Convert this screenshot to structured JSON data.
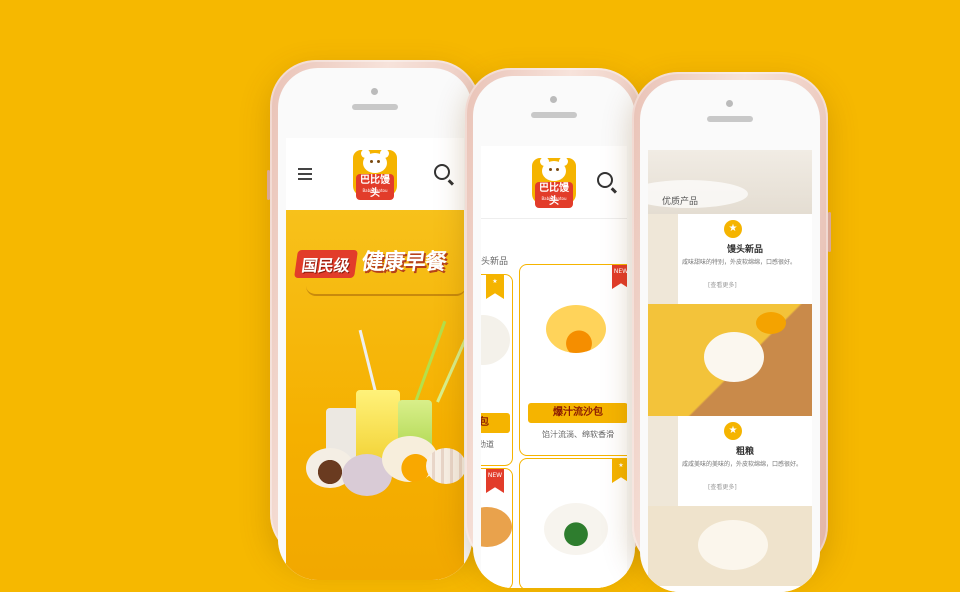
{
  "background_color": "#f6b800",
  "brand": {
    "logo_text": "巴比馒头",
    "logo_sub": "Babi Mantou",
    "accent": "#f5b400",
    "red": "#e23c2a"
  },
  "phone1": {
    "banner": {
      "tag": "国民级",
      "headline": "健康早餐"
    }
  },
  "phone2": {
    "section_label": "头新品",
    "cards": [
      {
        "label": "菜包",
        "desc": "香劲道",
        "badge": ""
      },
      {
        "label": "爆汁流沙包",
        "desc": "馅汁流淌、绵软香滑",
        "badge": "NEW"
      },
      {
        "label": "",
        "desc": "",
        "badge": "NEW"
      },
      {
        "label": "",
        "desc": "",
        "badge": "★"
      }
    ]
  },
  "phone3": {
    "section_title": "优质产品",
    "items": [
      {
        "title": "馒头新品",
        "desc": "咸味甜味的特别，外皮软绵绵，口感很好。",
        "more": "[查看更多]"
      },
      {
        "title": "粗粮",
        "desc": "咸咸美味的美味的，外皮软绵绵，口感很好。",
        "more": "[查看更多]"
      }
    ]
  }
}
